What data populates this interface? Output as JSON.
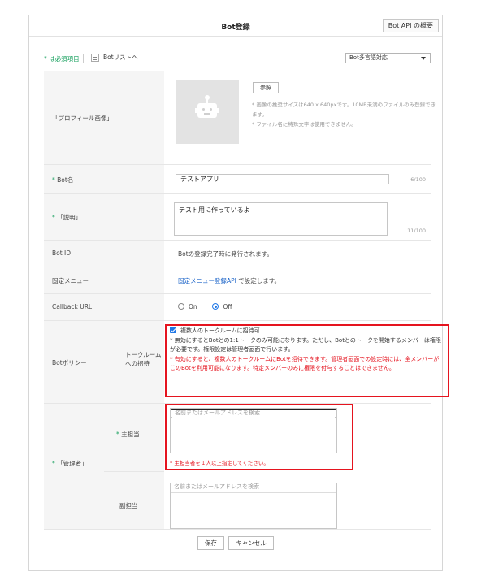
{
  "header": {
    "title": "Bot登録",
    "api_button": "Bot API の概要"
  },
  "toolbar": {
    "required_note": "* は必須項目",
    "bot_list_link": "Botリストへ",
    "language_select": "Bot多言語対応"
  },
  "profile": {
    "label": "「プロフィール画像」",
    "browse_button": "参照",
    "notes": [
      "* 画像の推奨サイズは640 x 640pxです。10MB未満のファイルのみ登録できます。",
      "* ファイル名に特殊文字は使用できません。"
    ]
  },
  "bot_name": {
    "label": "Bot名",
    "value": "テストアプリ",
    "counter": "6/100"
  },
  "description": {
    "label": "「説明」",
    "value": "テスト用に作っているよ",
    "counter": "11/100"
  },
  "bot_id": {
    "label": "Bot ID",
    "text": "Botの登録完了時に発行されます。"
  },
  "fixed_menu": {
    "label": "固定メニュー",
    "link": "固定メニュー登録API",
    "suffix": " で設定します。"
  },
  "callback_url": {
    "label": "Callback URL",
    "option_on": "On",
    "option_off": "Off",
    "selected": "Off"
  },
  "policy": {
    "label": "Botポリシー",
    "sublabel": "トークルームへの招待",
    "checkbox_label": "複数人のトークルームに招待可",
    "checked": true,
    "note_black": "* 無効にするとBotとの1:1トークのみ可能になります。ただし、Botとのトークを開始するメンバーは権限が必要です。権限設定は管理者画面で行います。",
    "note_red": "* 有効にすると、複数人のトークルームにBotを招待できます。管理者画面での設定時には、全メンバーがこのBotを利用可能になります。特定メンバーのみに権限を付与することはできません。"
  },
  "managers": {
    "label": "「管理者」",
    "primary_label": "主担当",
    "primary_placeholder": "名前またはメールアドレスを検索",
    "primary_warning": "* 主担当者を１人以上指定してください。",
    "secondary_label": "副担当",
    "secondary_placeholder": "名前またはメールアドレスを検索"
  },
  "footer": {
    "save": "保存",
    "cancel": "キャンセル"
  },
  "colors": {
    "required": "#19a15f",
    "highlight": "#e5141f",
    "link": "#1a63c8",
    "accent": "#1f77e6"
  }
}
